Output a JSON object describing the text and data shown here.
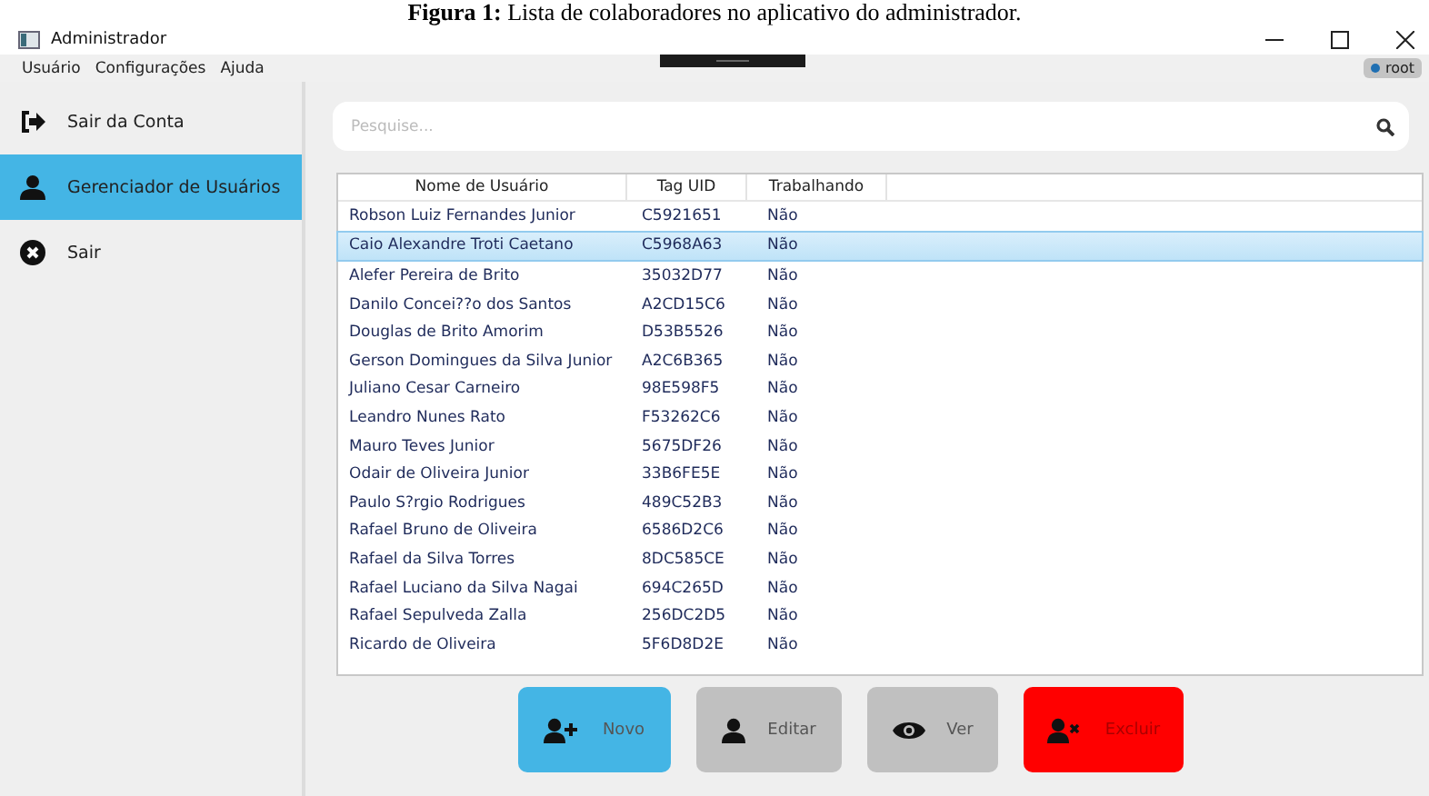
{
  "caption": {
    "label": "Figura 1:",
    "text": "Lista de colaboradores no aplicativo do administrador."
  },
  "window": {
    "title": "Administrador"
  },
  "menu": [
    "Usuário",
    "Configurações",
    "Ajuda"
  ],
  "user_badge": "root",
  "sidebar": {
    "items": [
      {
        "label": "Sair da Conta",
        "kind": "logout",
        "selected": false
      },
      {
        "label": "Gerenciador de Usuários",
        "kind": "user",
        "selected": true
      },
      {
        "label": "Sair",
        "kind": "close",
        "selected": false
      }
    ]
  },
  "search": {
    "placeholder": "Pesquise..."
  },
  "table": {
    "columns": [
      "Nome de Usuário",
      "Tag UID",
      "Trabalhando"
    ],
    "rows": [
      {
        "name": "Robson Luiz Fernandes Junior",
        "tag": "C5921651",
        "working": "Não",
        "selected": false
      },
      {
        "name": "Caio Alexandre Troti Caetano",
        "tag": "C5968A63",
        "working": "Não",
        "selected": true
      },
      {
        "name": "Alefer Pereira de Brito",
        "tag": "35032D77",
        "working": "Não",
        "selected": false
      },
      {
        "name": "Danilo Concei??o dos Santos",
        "tag": "A2CD15C6",
        "working": "Não",
        "selected": false
      },
      {
        "name": "Douglas de Brito Amorim",
        "tag": "D53B5526",
        "working": "Não",
        "selected": false
      },
      {
        "name": "Gerson Domingues da Silva Junior",
        "tag": "A2C6B365",
        "working": "Não",
        "selected": false
      },
      {
        "name": "Juliano Cesar Carneiro",
        "tag": "98E598F5",
        "working": "Não",
        "selected": false
      },
      {
        "name": "Leandro Nunes Rato",
        "tag": "F53262C6",
        "working": "Não",
        "selected": false
      },
      {
        "name": "Mauro Teves Junior",
        "tag": "5675DF26",
        "working": "Não",
        "selected": false
      },
      {
        "name": "Odair de Oliveira Junior",
        "tag": "33B6FE5E",
        "working": "Não",
        "selected": false
      },
      {
        "name": "Paulo S?rgio Rodrigues",
        "tag": "489C52B3",
        "working": "Não",
        "selected": false
      },
      {
        "name": "Rafael Bruno de Oliveira",
        "tag": "6586D2C6",
        "working": "Não",
        "selected": false
      },
      {
        "name": "Rafael da Silva Torres",
        "tag": "8DC585CE",
        "working": "Não",
        "selected": false
      },
      {
        "name": "Rafael Luciano da Silva Nagai",
        "tag": "694C265D",
        "working": "Não",
        "selected": false
      },
      {
        "name": "Rafael Sepulveda Zalla",
        "tag": "256DC2D5",
        "working": "Não",
        "selected": false
      },
      {
        "name": "Ricardo de Oliveira",
        "tag": "5F6D8D2E",
        "working": "Não",
        "selected": false
      }
    ]
  },
  "buttons": [
    {
      "label": "Novo",
      "kind": "new"
    },
    {
      "label": "Editar",
      "kind": "edit"
    },
    {
      "label": "Ver",
      "kind": "view"
    },
    {
      "label": "Excluir",
      "kind": "delete"
    }
  ]
}
